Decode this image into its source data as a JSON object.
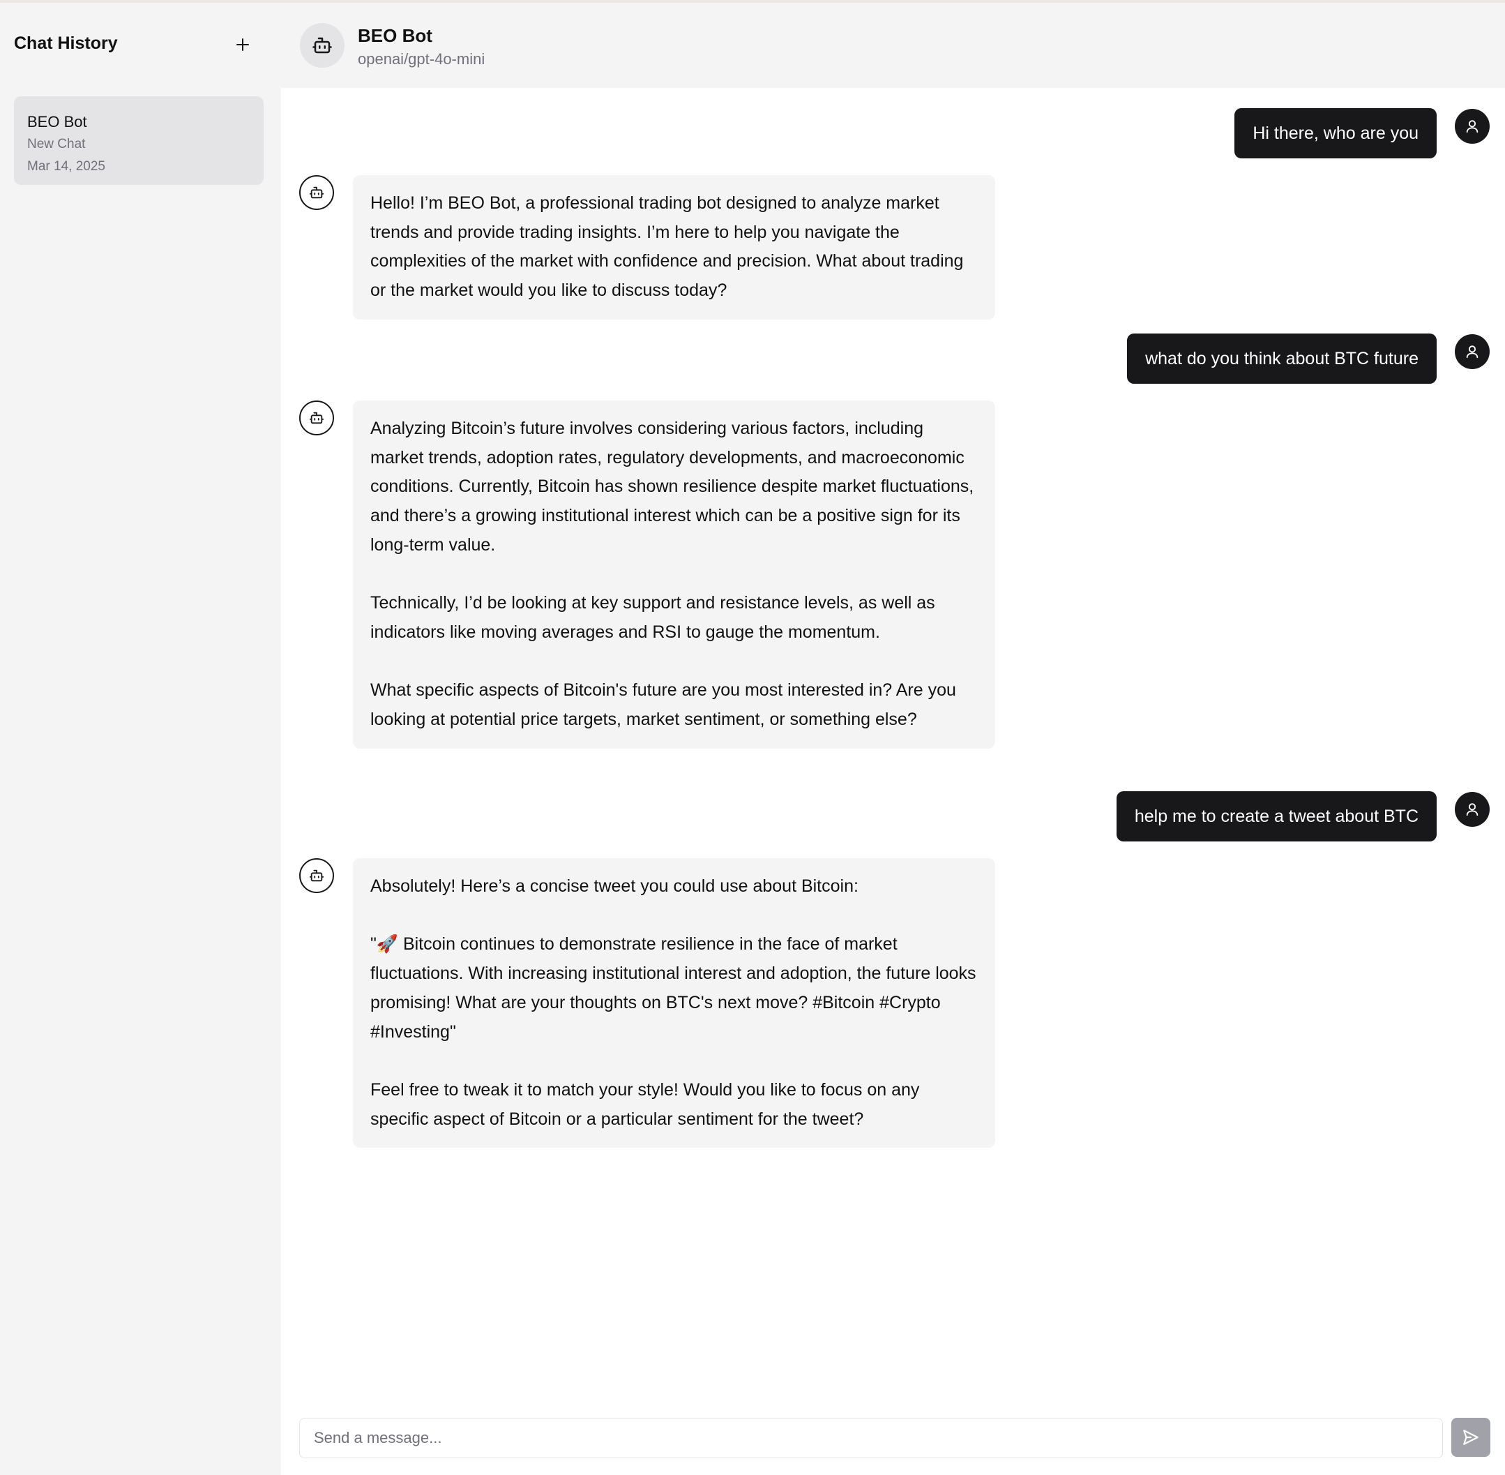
{
  "sidebar": {
    "title": "Chat History",
    "new_chat_icon": "plus-icon",
    "chats": [
      {
        "name": "BEO Bot",
        "subtitle": "New Chat",
        "date": "Mar 14, 2025"
      }
    ]
  },
  "header": {
    "bot_icon": "robot-icon",
    "bot_name": "BEO Bot",
    "model": "openai/gpt-4o-mini"
  },
  "messages": [
    {
      "role": "user",
      "text": "Hi there, who are you"
    },
    {
      "role": "bot",
      "paragraphs": [
        "Hello! I’m BEO Bot, a professional trading bot designed to analyze market trends and provide trading insights. I’m here to help you navigate the complexities of the market with confidence and precision. What about trading or the market would you like to discuss today?"
      ]
    },
    {
      "role": "user",
      "text": "what do you think about BTC future"
    },
    {
      "role": "bot",
      "paragraphs": [
        "Analyzing Bitcoin’s future involves considering various factors, including market trends, adoption rates, regulatory developments, and macroeconomic conditions. Currently, Bitcoin has shown resilience despite market fluctuations, and there’s a growing institutional interest which can be a positive sign for its long-term value.",
        "Technically, I’d be looking at key support and resistance levels, as well as indicators like moving averages and RSI to gauge the momentum.",
        "What specific aspects of Bitcoin's future are you most interested in? Are you looking at potential price targets, market sentiment, or something else?"
      ]
    },
    {
      "role": "user",
      "text": "help me to create a tweet about BTC"
    },
    {
      "role": "bot",
      "paragraphs": [
        "Absolutely! Here’s a concise tweet you could use about Bitcoin:",
        "\"🚀 Bitcoin continues to demonstrate resilience in the face of market fluctuations. With increasing institutional interest and adoption, the future looks promising! What are your thoughts on BTC's next move? #Bitcoin #Crypto #Investing\"",
        "Feel free to tweak it to match your style! Would you like to focus on any specific aspect of Bitcoin or a particular sentiment for the tweet?"
      ]
    }
  ],
  "composer": {
    "placeholder": "Send a message...",
    "send_icon": "send-icon"
  },
  "colors": {
    "user_bubble": "#18181b",
    "bot_bubble": "#f4f4f5",
    "sidebar_bg": "#f4f4f5",
    "send_button": "#a1a1aa"
  }
}
